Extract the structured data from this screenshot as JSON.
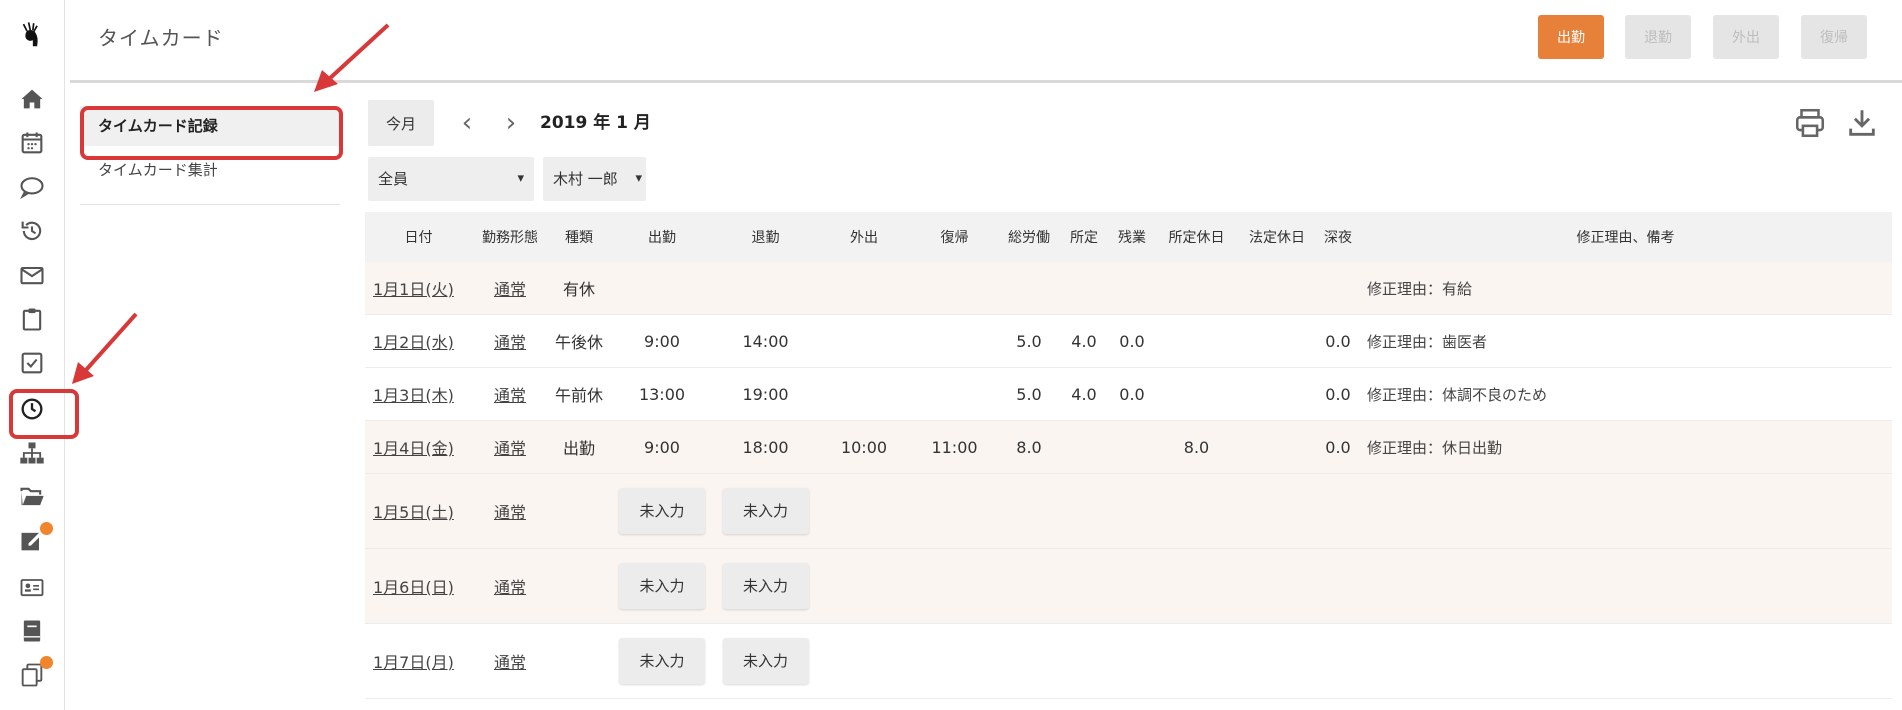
{
  "header": {
    "title": "タイムカード",
    "buttons": {
      "clock_in": "出勤",
      "clock_out": "退勤",
      "go_out": "外出",
      "return": "復帰"
    },
    "accent_color": "#e7813a"
  },
  "sidebar": {
    "icons": [
      "app-logo-icon",
      "home-icon",
      "calendar-icon",
      "chat-icon",
      "history-icon",
      "mail-icon",
      "clipboard-icon",
      "checkbox-icon",
      "clock-icon",
      "org-chart-icon",
      "folder-icon",
      "edit-icon",
      "id-card-icon",
      "book-icon",
      "copy-icon"
    ],
    "active": "clock-icon"
  },
  "submenu": {
    "items": [
      {
        "label": "タイムカード記録",
        "active": true
      },
      {
        "label": "タイムカード集計",
        "active": false
      }
    ]
  },
  "toolbar": {
    "today_label": "今月",
    "month_label": "2019 年 1 月",
    "filter_group": "全員",
    "filter_user": "木村 一郎"
  },
  "table": {
    "headers": [
      "日付",
      "勤務形態",
      "種類",
      "出勤",
      "退勤",
      "外出",
      "復帰",
      "総労働",
      "所定",
      "残業",
      "所定休日",
      "法定休日",
      "深夜",
      "修正理由、備考"
    ],
    "rows": [
      {
        "date": "1月1日(火)",
        "work_type": "通常",
        "kind": "有休",
        "in": "",
        "out": "",
        "go_out": "",
        "return": "",
        "total": "",
        "scheduled": "",
        "overtime": "",
        "sched_holiday": "",
        "legal_holiday": "",
        "late_night": "",
        "remark": "修正理由：有給"
      },
      {
        "date": "1月2日(水)",
        "work_type": "通常",
        "kind": "午後休",
        "in": "9:00",
        "out": "14:00",
        "go_out": "",
        "return": "",
        "total": "5.0",
        "scheduled": "4.0",
        "overtime": "0.0",
        "sched_holiday": "",
        "legal_holiday": "",
        "late_night": "0.0",
        "remark": "修正理由：歯医者"
      },
      {
        "date": "1月3日(木)",
        "work_type": "通常",
        "kind": "午前休",
        "in": "13:00",
        "out": "19:00",
        "go_out": "",
        "return": "",
        "total": "5.0",
        "scheduled": "4.0",
        "overtime": "0.0",
        "sched_holiday": "",
        "legal_holiday": "",
        "late_night": "0.0",
        "remark": "修正理由：体調不良のため"
      },
      {
        "date": "1月4日(金)",
        "work_type": "通常",
        "kind": "出勤",
        "in": "9:00",
        "out": "18:00",
        "go_out": "10:00",
        "return": "11:00",
        "total": "8.0",
        "scheduled": "",
        "overtime": "",
        "sched_holiday": "8.0",
        "legal_holiday": "",
        "late_night": "0.0",
        "remark": "修正理由：休日出勤"
      },
      {
        "date": "1月5日(土)",
        "work_type": "通常",
        "kind": "",
        "unset_label": "未入力",
        "remark": ""
      },
      {
        "date": "1月6日(日)",
        "work_type": "通常",
        "kind": "",
        "unset_label": "未入力",
        "remark": ""
      },
      {
        "date": "1月7日(月)",
        "work_type": "通常",
        "kind": "",
        "unset_label": "未入力",
        "remark": ""
      }
    ]
  },
  "annotation_color": "#d93838"
}
